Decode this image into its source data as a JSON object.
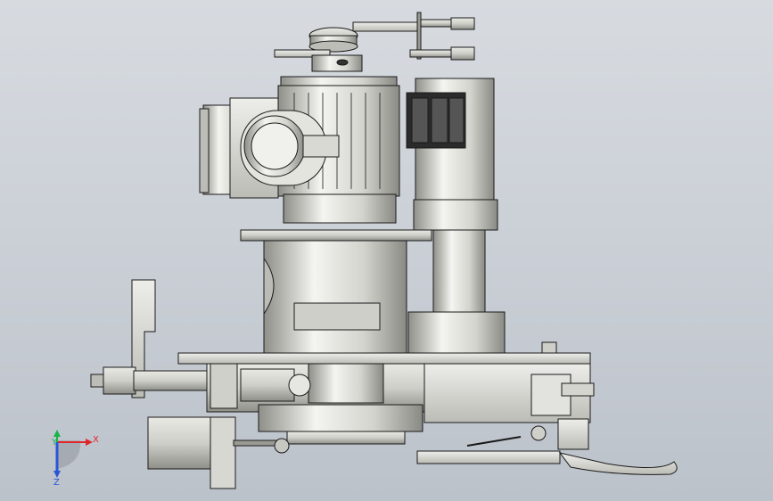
{
  "app": {
    "view": "CAD 3D viewport"
  },
  "triad": {
    "x_label": "X",
    "y_label": "Y",
    "z_label": "Z",
    "x_color": "#e0262b",
    "y_color": "#18b34a",
    "z_color": "#2a55d6"
  },
  "colors": {
    "background_top": "#d7dbe0",
    "background_bottom": "#bcc2ca",
    "metal_light": "#f2f2ef",
    "metal_mid": "#c8c8c2",
    "metal_dark": "#8e8e88",
    "edge": "#1a1a1a",
    "dark_part": "#2b2b2b"
  }
}
